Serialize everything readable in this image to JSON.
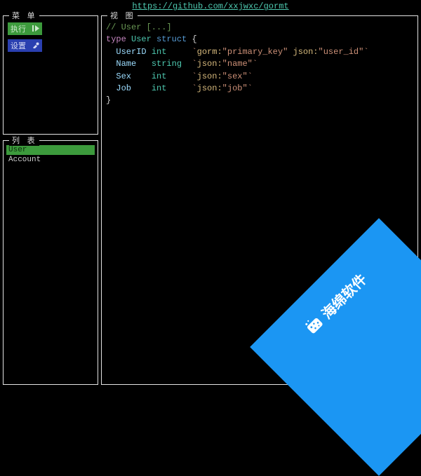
{
  "header": {
    "repo_url": "https://github.com/xxjwxc/gormt"
  },
  "panels": {
    "menu_title": "菜 单",
    "list_title": "列 表",
    "view_title": "视 图"
  },
  "menu": {
    "run_label": "执行",
    "set_label": "设置"
  },
  "tables": {
    "items": [
      {
        "name": "User",
        "selected": true
      },
      {
        "name": "Account",
        "selected": false
      }
    ]
  },
  "code": {
    "comment": "// User [...]",
    "kw_type": "type",
    "struct_name": "User",
    "kw_struct": "struct",
    "brace_open": "{",
    "brace_close": "}",
    "fields": [
      {
        "name": "UserID",
        "type": "int",
        "tag": "`gorm:\"primary_key\" json:\"user_id\"`"
      },
      {
        "name": "Name",
        "type": "string",
        "tag": "`json:\"name\"`"
      },
      {
        "name": "Sex",
        "type": "int",
        "tag": "`json:\"sex\"`"
      },
      {
        "name": "Job",
        "type": "int",
        "tag": "`json:\"job\"`"
      }
    ]
  },
  "watermark": {
    "text": "海绵软件"
  }
}
